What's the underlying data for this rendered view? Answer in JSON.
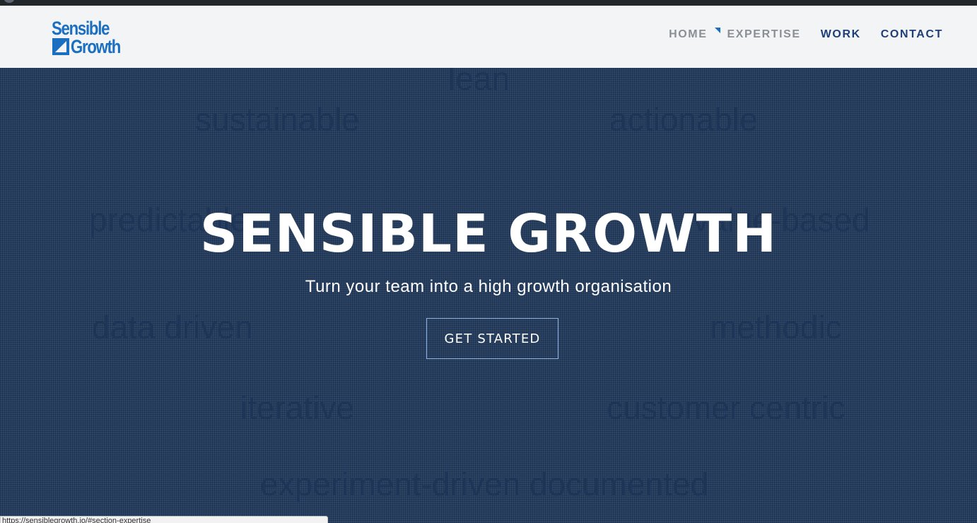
{
  "brand": {
    "line1": "Sensible",
    "line2": "Growth",
    "color": "#1a6fc0"
  },
  "nav": {
    "items": [
      {
        "label": "HOME"
      },
      {
        "label": "EXPERTISE"
      },
      {
        "label": "WORK"
      },
      {
        "label": "CONTACT"
      }
    ]
  },
  "hero": {
    "title": "SENSIBLE GROWTH",
    "subtitle": "Turn your team into a high growth organisation",
    "cta": "GET STARTED",
    "background_words": [
      "lean",
      "sustainable",
      "actionable",
      "predictable",
      "value-based",
      "data driven",
      "methodic",
      "iterative",
      "customer centric",
      "experiment-driven documented"
    ]
  },
  "status": {
    "url": "https://sensiblegrowth.io/#section-expertise"
  }
}
